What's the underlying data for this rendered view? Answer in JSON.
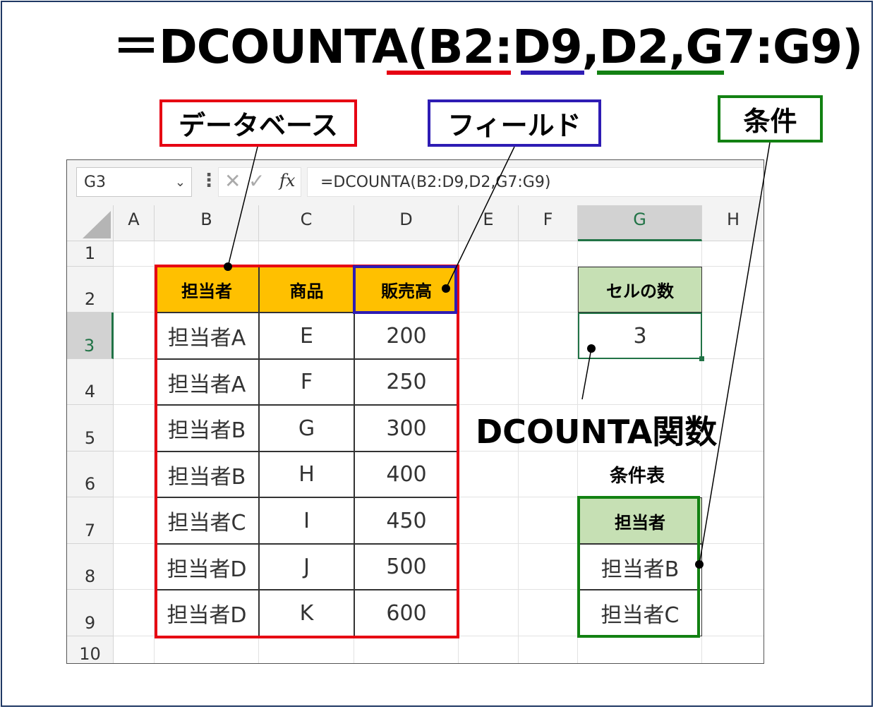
{
  "title": {
    "prefix": "＝DCOUNTA(",
    "arg1": "B2:D9",
    "sep1": ",",
    "arg2": "D2",
    "sep2": ",",
    "arg3": "G7:G9",
    "suffix": ")"
  },
  "labels": {
    "database": "データベース",
    "field": "フィールド",
    "criteria": "条件",
    "function_name": "DCOUNTA関数",
    "criteria_table": "条件表"
  },
  "colors": {
    "database": "#e60012",
    "field": "#2e1cb4",
    "criteria": "#128112",
    "header_fill": "#ffc000",
    "criteria_fill": "#c6e0b4",
    "excel_accent": "#217346"
  },
  "excel": {
    "name_box": "G3",
    "formula": "=DCOUNTA(B2:D9,D2,G7:G9)",
    "columns": [
      "A",
      "B",
      "C",
      "D",
      "E",
      "F",
      "G",
      "H"
    ],
    "rows": [
      "1",
      "2",
      "3",
      "4",
      "5",
      "6",
      "7",
      "8",
      "9",
      "10"
    ],
    "selected_cell": "G3",
    "table": {
      "headers": [
        "担当者",
        "商品",
        "販売高"
      ],
      "rows": [
        [
          "担当者A",
          "E",
          "200"
        ],
        [
          "担当者A",
          "F",
          "250"
        ],
        [
          "担当者B",
          "G",
          "300"
        ],
        [
          "担当者B",
          "H",
          "400"
        ],
        [
          "担当者C",
          "I",
          "450"
        ],
        [
          "担当者D",
          "J",
          "500"
        ],
        [
          "担当者D",
          "K",
          "600"
        ]
      ]
    },
    "result": {
      "header": "セルの数",
      "value": "3"
    },
    "criteria": {
      "header": "担当者",
      "values": [
        "担当者B",
        "担当者C"
      ]
    }
  }
}
